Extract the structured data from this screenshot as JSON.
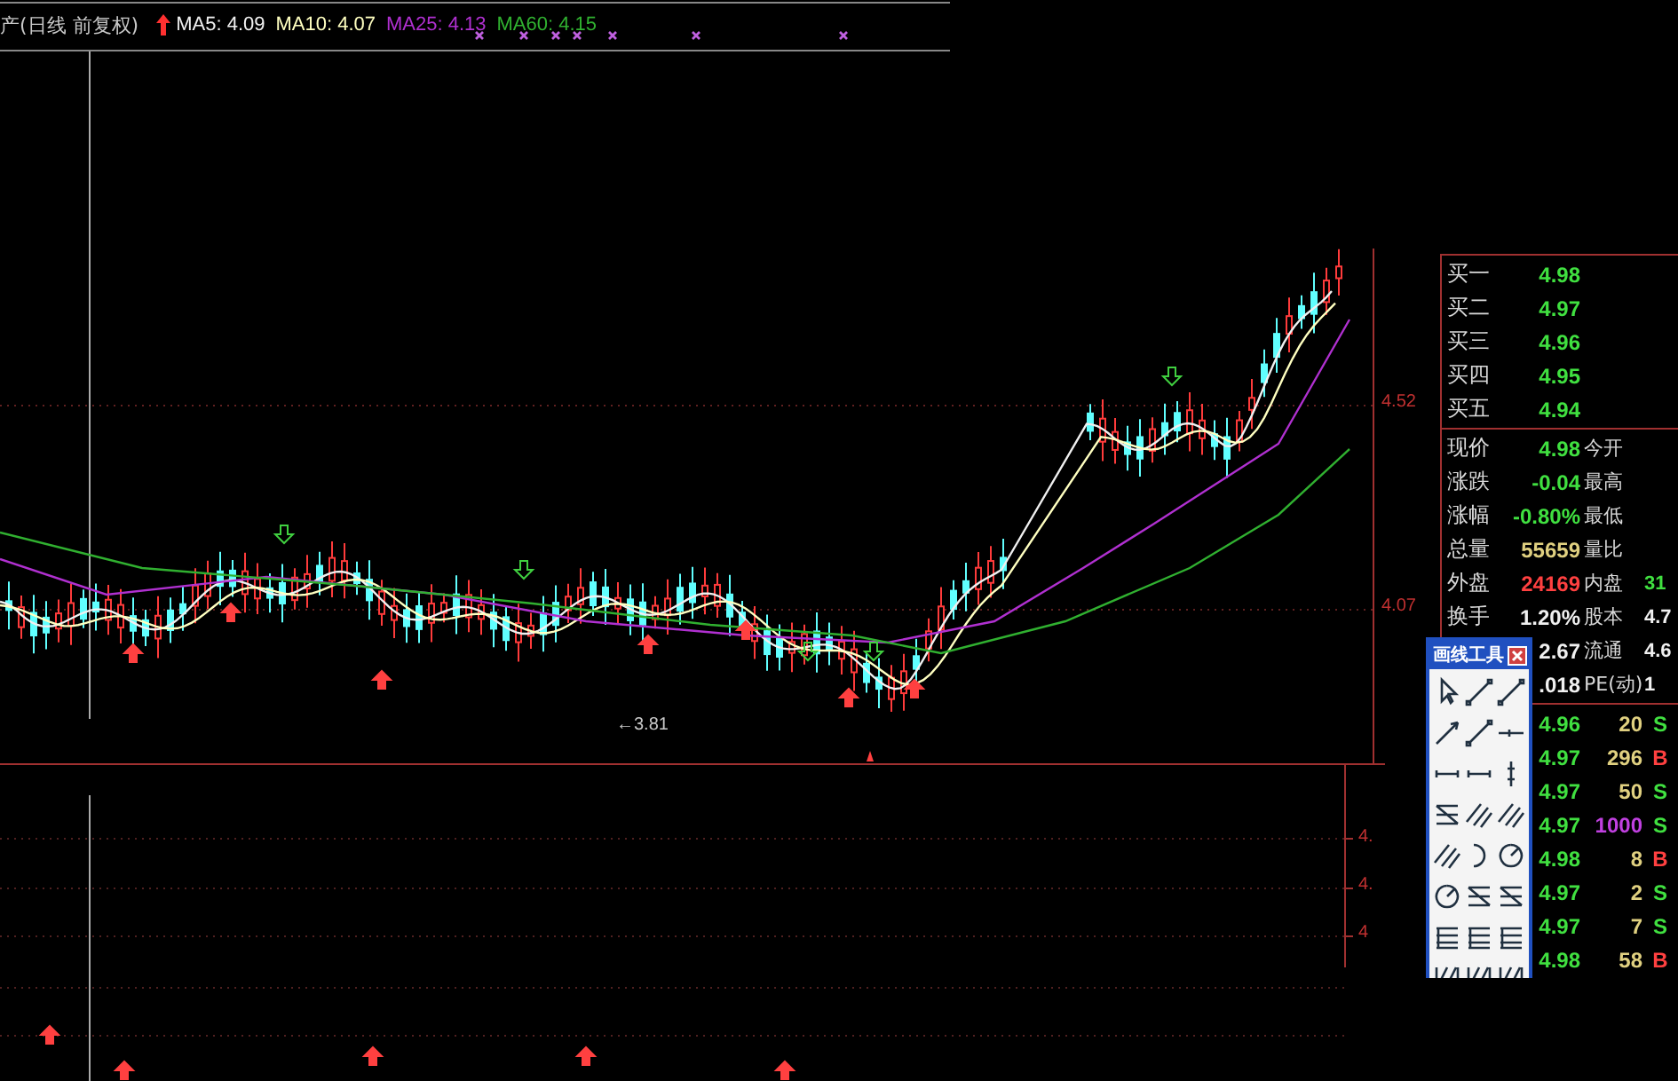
{
  "chart": {
    "title": "产(日线 前复权)",
    "indicators": [
      {
        "label": "MA5: 4.09",
        "color": "#f0f0f0"
      },
      {
        "label": "MA10: 4.07",
        "color": "#ffffc0"
      },
      {
        "label": "MA25: 4.13",
        "color": "#b030d0"
      },
      {
        "label": "MA60: 4.15",
        "color": "#30b030"
      }
    ],
    "price_labels": [
      "4.52",
      "4.07"
    ],
    "low_label": "←3.81",
    "lower_labels": [
      "4.",
      "4.",
      "4"
    ]
  },
  "bids": [
    {
      "label": "买一",
      "price": "4.98"
    },
    {
      "label": "买二",
      "price": "4.97"
    },
    {
      "label": "买三",
      "price": "4.96"
    },
    {
      "label": "买四",
      "price": "4.95"
    },
    {
      "label": "买五",
      "price": "4.94"
    }
  ],
  "quote": [
    {
      "label": "现价",
      "value": "4.98",
      "color": "#40e040",
      "label2": "今开"
    },
    {
      "label": "涨跌",
      "value": "-0.04",
      "color": "#40e040",
      "label2": "最高"
    },
    {
      "label": "涨幅",
      "value": "-0.80%",
      "color": "#40e040",
      "label2": "最低"
    },
    {
      "label": "总量",
      "value": "55659",
      "color": "#e0d080",
      "label2": "量比"
    },
    {
      "label": "外盘",
      "value": "24169",
      "color": "#ff4040",
      "label2": "内盘",
      "value2": {
        "text": "31",
        "color": "#40e040"
      }
    },
    {
      "label": "换手",
      "value": "1.20%",
      "color": "#f0f0f0",
      "label2": "股本",
      "value2": {
        "text": "4.7",
        "color": "#f0f0f0"
      }
    },
    {
      "value": "2.67",
      "color": "#f0f0f0",
      "label2": "流通",
      "value2": {
        "text": "4.6",
        "color": "#f0f0f0"
      }
    },
    {
      "value": ".018",
      "color": "#f0f0f0",
      "label2": "PE(动)",
      "value2": {
        "text": "1",
        "color": "#f0f0f0"
      }
    }
  ],
  "ticks": [
    {
      "price": "4.96",
      "volume": "20",
      "color": "#e0d080",
      "side": "S",
      "kind": "sell"
    },
    {
      "price": "4.97",
      "volume": "296",
      "color": "#e0d080",
      "side": "B",
      "kind": "buy"
    },
    {
      "price": "4.97",
      "volume": "50",
      "color": "#e0d080",
      "side": "S",
      "kind": "sell"
    },
    {
      "price": "4.97",
      "volume": "1000",
      "color": "#c040e0",
      "side": "S",
      "kind": "sell"
    },
    {
      "price": "4.98",
      "volume": "8",
      "color": "#e0d080",
      "side": "B",
      "kind": "buy"
    },
    {
      "price": "4.97",
      "volume": "2",
      "color": "#e0d080",
      "side": "S",
      "kind": "sell"
    },
    {
      "price": "4.97",
      "volume": "7",
      "color": "#e0d080",
      "side": "S",
      "kind": "sell"
    },
    {
      "price": "4.98",
      "volume": "58",
      "color": "#e0d080",
      "side": "B",
      "kind": "buy"
    }
  ],
  "drawing_tools": {
    "title": "画线工具"
  }
}
